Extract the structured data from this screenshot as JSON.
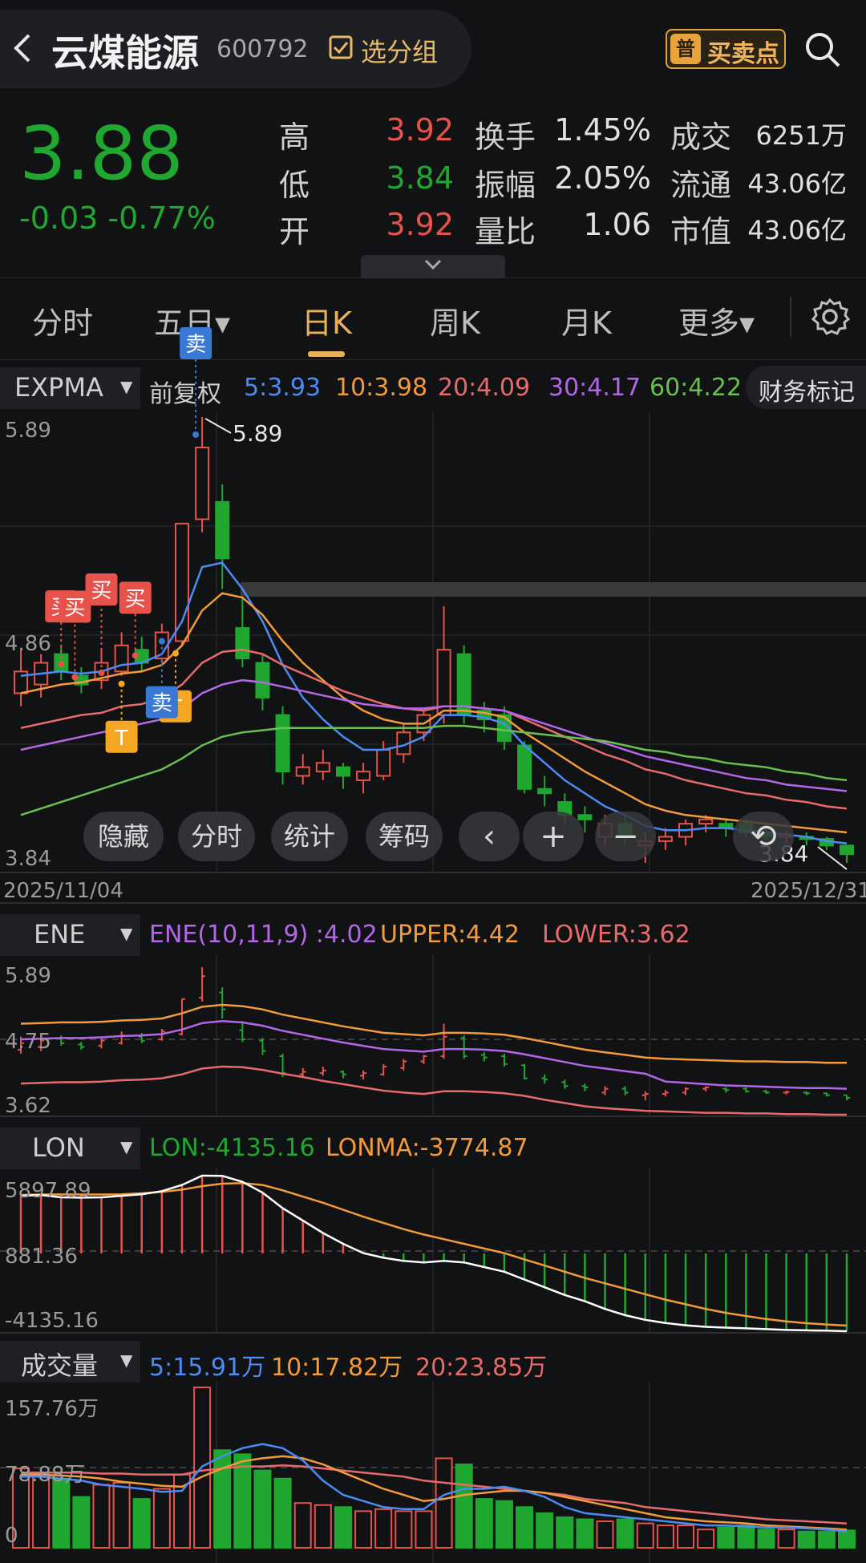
{
  "header": {
    "stock_name": "云煤能源",
    "stock_code": "600792",
    "group_label": "选分组",
    "bs_badge": "普",
    "bs_label": "买卖点"
  },
  "quote": {
    "price": "3.88",
    "change": "-0.03 -0.77%",
    "rows": [
      {
        "l1": "高",
        "v1": "3.92",
        "c1": "#e7534b",
        "l2": "换手",
        "v2": "1.45%",
        "l3": "成交",
        "v3": "6251万"
      },
      {
        "l1": "低",
        "v1": "3.84",
        "c1": "#1fa72f",
        "l2": "振幅",
        "v2": "2.05%",
        "l3": "流通",
        "v3": "43.06亿"
      },
      {
        "l1": "开",
        "v1": "3.92",
        "c1": "#e7534b",
        "l2": "量比",
        "v2": "1.06",
        "l3": "市值",
        "v3": "43.06亿"
      }
    ]
  },
  "tabs": [
    "分时",
    "五日▾",
    "日K",
    "周K",
    "月K",
    "更多▾"
  ],
  "active_tab": "日K",
  "colors": {
    "up": "#e7534b",
    "down": "#1fa72f",
    "ma5": "#4b8bf5",
    "ma10": "#f39a3a",
    "ma20": "#e86a6a",
    "ma30": "#b466e8",
    "ma60": "#6bbf4e"
  },
  "main": {
    "indicator": "EXPMA",
    "adjust": "前复权",
    "ma5": "5:3.93",
    "ma10": "10:3.98",
    "ma20": "20:4.09",
    "ma30": "30:4.17",
    "ma60": "60:4.22",
    "finance_label": "财务标记",
    "y_top": "5.89",
    "y_mid": "4.86",
    "y_bot": "3.84",
    "high_tag": "5.89",
    "low_tag": "3.84",
    "date_start": "2025/11/04",
    "date_end": "2025/12/31",
    "buy_label": "买",
    "sell_label": "卖",
    "t_label": "T",
    "tools": [
      "隐藏",
      "分时",
      "统计",
      "筹码"
    ]
  },
  "ene": {
    "name": "ENE",
    "val": "ENE(10,11,9)  :4.02",
    "upper": "UPPER:4.42",
    "lower": "LOWER:3.62",
    "y_top": "5.89",
    "y_mid": "4.75",
    "y_bot": "3.62"
  },
  "lon": {
    "name": "LON",
    "val": "LON:-4135.16",
    "ma": "LONMA:-3774.87",
    "y_top": "5897.89",
    "y_mid": "881.36",
    "y_bot": "-4135.16"
  },
  "vol": {
    "name": "成交量",
    "ma5": "5:15.91万",
    "ma10": "10:17.82万",
    "ma20": "20:23.85万",
    "y_top": "157.76万",
    "y_mid": "78.88万",
    "y_bot": "0"
  },
  "chart_data": {
    "type": "candlestick",
    "x_range": [
      "2025/11/04",
      "2025/12/31"
    ],
    "ylim": [
      3.84,
      5.89
    ],
    "candles": [
      {
        "o": 4.62,
        "c": 4.72,
        "h": 4.82,
        "l": 4.56
      },
      {
        "o": 4.66,
        "c": 4.76,
        "h": 4.8,
        "l": 4.6
      },
      {
        "o": 4.8,
        "c": 4.72,
        "h": 4.84,
        "l": 4.68
      },
      {
        "o": 4.7,
        "c": 4.66,
        "h": 4.74,
        "l": 4.62
      },
      {
        "o": 4.68,
        "c": 4.76,
        "h": 4.82,
        "l": 4.64
      },
      {
        "o": 4.72,
        "c": 4.84,
        "h": 4.9,
        "l": 4.7
      },
      {
        "o": 4.82,
        "c": 4.76,
        "h": 4.88,
        "l": 4.72
      },
      {
        "o": 4.78,
        "c": 4.9,
        "h": 4.94,
        "l": 4.76
      },
      {
        "o": 4.86,
        "c": 5.4,
        "h": 5.4,
        "l": 4.84
      },
      {
        "o": 5.42,
        "c": 5.75,
        "h": 5.89,
        "l": 5.36
      },
      {
        "o": 5.5,
        "c": 5.24,
        "h": 5.58,
        "l": 5.1
      },
      {
        "o": 4.92,
        "c": 4.78,
        "h": 5.06,
        "l": 4.74
      },
      {
        "o": 4.76,
        "c": 4.6,
        "h": 4.8,
        "l": 4.54
      },
      {
        "o": 4.52,
        "c": 4.26,
        "h": 4.56,
        "l": 4.2
      },
      {
        "o": 4.24,
        "c": 4.28,
        "h": 4.34,
        "l": 4.2
      },
      {
        "o": 4.26,
        "c": 4.3,
        "h": 4.36,
        "l": 4.22
      },
      {
        "o": 4.28,
        "c": 4.24,
        "h": 4.3,
        "l": 4.18
      },
      {
        "o": 4.22,
        "c": 4.26,
        "h": 4.3,
        "l": 4.16
      },
      {
        "o": 4.24,
        "c": 4.36,
        "h": 4.4,
        "l": 4.22
      },
      {
        "o": 4.34,
        "c": 4.44,
        "h": 4.48,
        "l": 4.3
      },
      {
        "o": 4.44,
        "c": 4.52,
        "h": 4.54,
        "l": 4.4
      },
      {
        "o": 4.52,
        "c": 4.82,
        "h": 5.02,
        "l": 4.48
      },
      {
        "o": 4.8,
        "c": 4.52,
        "h": 4.84,
        "l": 4.48
      },
      {
        "o": 4.54,
        "c": 4.5,
        "h": 4.58,
        "l": 4.44
      },
      {
        "o": 4.52,
        "c": 4.4,
        "h": 4.56,
        "l": 4.36
      },
      {
        "o": 4.38,
        "c": 4.18,
        "h": 4.4,
        "l": 4.16
      },
      {
        "o": 4.18,
        "c": 4.16,
        "h": 4.24,
        "l": 4.1
      },
      {
        "o": 4.12,
        "c": 4.06,
        "h": 4.16,
        "l": 4.02
      },
      {
        "o": 4.06,
        "c": 4.04,
        "h": 4.1,
        "l": 3.98
      },
      {
        "o": 3.96,
        "c": 4.02,
        "h": 4.06,
        "l": 3.92
      },
      {
        "o": 4.02,
        "c": 3.96,
        "h": 4.06,
        "l": 3.92
      },
      {
        "o": 3.92,
        "c": 3.94,
        "h": 3.98,
        "l": 3.84
      },
      {
        "o": 3.94,
        "c": 3.96,
        "h": 4.0,
        "l": 3.9
      },
      {
        "o": 3.96,
        "c": 4.02,
        "h": 4.04,
        "l": 3.92
      },
      {
        "o": 4.02,
        "c": 4.04,
        "h": 4.06,
        "l": 3.98
      },
      {
        "o": 4.02,
        "c": 4.0,
        "h": 4.04,
        "l": 3.96
      },
      {
        "o": 4.02,
        "c": 3.98,
        "h": 4.04,
        "l": 3.96
      },
      {
        "o": 3.98,
        "c": 3.96,
        "h": 4.0,
        "l": 3.94
      },
      {
        "o": 3.96,
        "c": 3.97,
        "h": 3.99,
        "l": 3.93
      },
      {
        "o": 3.96,
        "c": 3.95,
        "h": 3.98,
        "l": 3.92
      },
      {
        "o": 3.95,
        "c": 3.92,
        "h": 3.96,
        "l": 3.9
      },
      {
        "o": 3.92,
        "c": 3.88,
        "h": 3.92,
        "l": 3.84
      }
    ],
    "ema": {
      "ma5": [
        4.7,
        4.71,
        4.72,
        4.71,
        4.72,
        4.75,
        4.76,
        4.8,
        4.95,
        5.2,
        5.22,
        5.1,
        4.95,
        4.75,
        4.6,
        4.5,
        4.42,
        4.36,
        4.36,
        4.38,
        4.42,
        4.52,
        4.52,
        4.51,
        4.48,
        4.38,
        4.3,
        4.22,
        4.16,
        4.1,
        4.06,
        4.01,
        3.99,
        3.99,
        4.0,
        4.0,
        3.99,
        3.98,
        3.97,
        3.96,
        3.94,
        3.93
      ],
      "ma10": [
        4.62,
        4.64,
        4.66,
        4.67,
        4.69,
        4.71,
        4.72,
        4.75,
        4.84,
        5.0,
        5.08,
        5.06,
        4.98,
        4.86,
        4.76,
        4.68,
        4.6,
        4.54,
        4.5,
        4.48,
        4.48,
        4.54,
        4.54,
        4.53,
        4.51,
        4.44,
        4.38,
        4.32,
        4.26,
        4.21,
        4.16,
        4.11,
        4.08,
        4.06,
        4.05,
        4.04,
        4.03,
        4.02,
        4.01,
        4.0,
        3.99,
        3.98
      ],
      "ma20": [
        4.46,
        4.48,
        4.5,
        4.52,
        4.53,
        4.56,
        4.57,
        4.6,
        4.66,
        4.76,
        4.81,
        4.82,
        4.8,
        4.75,
        4.71,
        4.67,
        4.63,
        4.6,
        4.57,
        4.55,
        4.54,
        4.56,
        4.56,
        4.55,
        4.54,
        4.5,
        4.46,
        4.42,
        4.38,
        4.34,
        4.31,
        4.27,
        4.25,
        4.22,
        4.2,
        4.18,
        4.16,
        4.15,
        4.13,
        4.12,
        4.1,
        4.09
      ],
      "ma30": [
        4.36,
        4.38,
        4.4,
        4.42,
        4.44,
        4.46,
        4.48,
        4.5,
        4.55,
        4.62,
        4.66,
        4.68,
        4.67,
        4.65,
        4.63,
        4.61,
        4.59,
        4.57,
        4.56,
        4.55,
        4.55,
        4.56,
        4.56,
        4.55,
        4.54,
        4.51,
        4.48,
        4.45,
        4.42,
        4.39,
        4.36,
        4.33,
        4.31,
        4.29,
        4.27,
        4.25,
        4.23,
        4.22,
        4.2,
        4.19,
        4.18,
        4.17
      ],
      "ma60": [
        4.06,
        4.09,
        4.12,
        4.15,
        4.18,
        4.21,
        4.24,
        4.27,
        4.32,
        4.38,
        4.42,
        4.44,
        4.45,
        4.46,
        4.46,
        4.46,
        4.46,
        4.46,
        4.46,
        4.46,
        4.46,
        4.47,
        4.47,
        4.46,
        4.45,
        4.44,
        4.43,
        4.42,
        4.41,
        4.4,
        4.38,
        4.36,
        4.35,
        4.33,
        4.32,
        4.3,
        4.29,
        4.28,
        4.26,
        4.25,
        4.23,
        4.22
      ]
    },
    "markers": [
      {
        "i": 2,
        "type": "buy"
      },
      {
        "i": 3,
        "type": "buy"
      },
      {
        "i": 4,
        "type": "buy"
      },
      {
        "i": 6,
        "type": "buy"
      },
      {
        "i": 5,
        "type": "T"
      },
      {
        "i": 8,
        "type": "T"
      },
      {
        "i": 7,
        "type": "sell"
      },
      {
        "i": 9,
        "type": "sell"
      }
    ],
    "ene": {
      "ylim": [
        3.62,
        5.89
      ],
      "upper": [
        5.02,
        5.03,
        5.04,
        5.04,
        5.05,
        5.07,
        5.08,
        5.1,
        5.18,
        5.28,
        5.31,
        5.29,
        5.24,
        5.16,
        5.1,
        5.04,
        4.98,
        4.93,
        4.88,
        4.86,
        4.84,
        4.88,
        4.88,
        4.87,
        4.85,
        4.8,
        4.74,
        4.68,
        4.62,
        4.58,
        4.54,
        4.5,
        4.48,
        4.47,
        4.46,
        4.45,
        4.44,
        4.44,
        4.43,
        4.43,
        4.42,
        4.42
      ],
      "mid": [
        4.78,
        4.79,
        4.8,
        4.8,
        4.81,
        4.83,
        4.84,
        4.86,
        4.93,
        5.03,
        5.06,
        5.04,
        4.99,
        4.91,
        4.85,
        4.79,
        4.73,
        4.68,
        4.63,
        4.61,
        4.59,
        4.63,
        4.63,
        4.62,
        4.6,
        4.55,
        4.49,
        4.43,
        4.37,
        4.33,
        4.29,
        4.25,
        4.13,
        4.11,
        4.09,
        4.07,
        4.06,
        4.05,
        4.04,
        4.03,
        4.03,
        4.02
      ],
      "lower": [
        4.1,
        4.11,
        4.12,
        4.12,
        4.13,
        4.15,
        4.16,
        4.18,
        4.24,
        4.33,
        4.36,
        4.35,
        4.31,
        4.25,
        4.2,
        4.14,
        4.09,
        4.04,
        3.99,
        3.96,
        3.94,
        3.98,
        3.98,
        3.97,
        3.95,
        3.91,
        3.85,
        3.8,
        3.75,
        3.72,
        3.7,
        3.68,
        3.67,
        3.66,
        3.65,
        3.65,
        3.64,
        3.64,
        3.63,
        3.63,
        3.62,
        3.62
      ]
    },
    "lon": {
      "ylim": [
        -4135.16,
        5897.89
      ],
      "lon": [
        4600,
        4650,
        4500,
        4480,
        4500,
        4600,
        4700,
        4900,
        5300,
        5897.89,
        5880,
        5500,
        4800,
        3800,
        3000,
        2200,
        1500,
        900,
        600,
        400,
        300,
        400,
        300,
        0,
        -300,
        -800,
        -1300,
        -1800,
        -2200,
        -2700,
        -3100,
        -3400,
        -3600,
        -3750,
        -3850,
        -3900,
        -3950,
        -4000,
        -4050,
        -4080,
        -4100,
        -4135.16
      ],
      "lonma": [
        4650,
        4680,
        4690,
        4680,
        4680,
        4700,
        4760,
        4850,
        5000,
        5220,
        5380,
        5420,
        5300,
        4950,
        4550,
        4150,
        3700,
        3250,
        2850,
        2450,
        2100,
        1800,
        1500,
        1200,
        900,
        500,
        100,
        -300,
        -700,
        -1050,
        -1400,
        -1750,
        -2100,
        -2400,
        -2700,
        -2950,
        -3150,
        -3350,
        -3500,
        -3620,
        -3700,
        -3774.87
      ]
    },
    "volume": {
      "ylim": [
        0,
        157.76
      ],
      "values": [
        78,
        74,
        68,
        50,
        62,
        64,
        48,
        58,
        72,
        157.76,
        96,
        92,
        76,
        68,
        44,
        42,
        40,
        36,
        38,
        36,
        36,
        88,
        82,
        48,
        46,
        40,
        34,
        30,
        28,
        26,
        28,
        24,
        22,
        22,
        18,
        20,
        22,
        18,
        18,
        16,
        16,
        17
      ],
      "ma5": [
        70,
        70,
        68,
        66,
        62,
        60,
        58,
        55,
        56,
        80,
        90,
        98,
        102,
        98,
        86,
        66,
        52,
        46,
        40,
        38,
        38,
        52,
        58,
        58,
        60,
        56,
        50,
        40,
        34,
        32,
        30,
        28,
        26,
        24,
        22,
        22,
        21,
        20,
        20,
        19,
        18,
        15.91
      ],
      "ma10": [
        72,
        72,
        71,
        70,
        68,
        65,
        63,
        61,
        60,
        70,
        78,
        85,
        88,
        90,
        88,
        82,
        74,
        66,
        58,
        52,
        46,
        48,
        52,
        54,
        56,
        56,
        54,
        50,
        46,
        42,
        38,
        34,
        30,
        28,
        26,
        25,
        24,
        22,
        21,
        20,
        19,
        17.82
      ],
      "ma20": [
        74,
        74,
        74,
        74,
        73,
        73,
        72,
        72,
        72,
        76,
        78,
        80,
        80,
        81,
        80,
        78,
        76,
        74,
        72,
        70,
        66,
        64,
        62,
        60,
        58,
        56,
        54,
        52,
        48,
        46,
        44,
        40,
        38,
        36,
        34,
        32,
        30,
        28,
        27,
        26,
        25,
        23.85
      ]
    }
  }
}
